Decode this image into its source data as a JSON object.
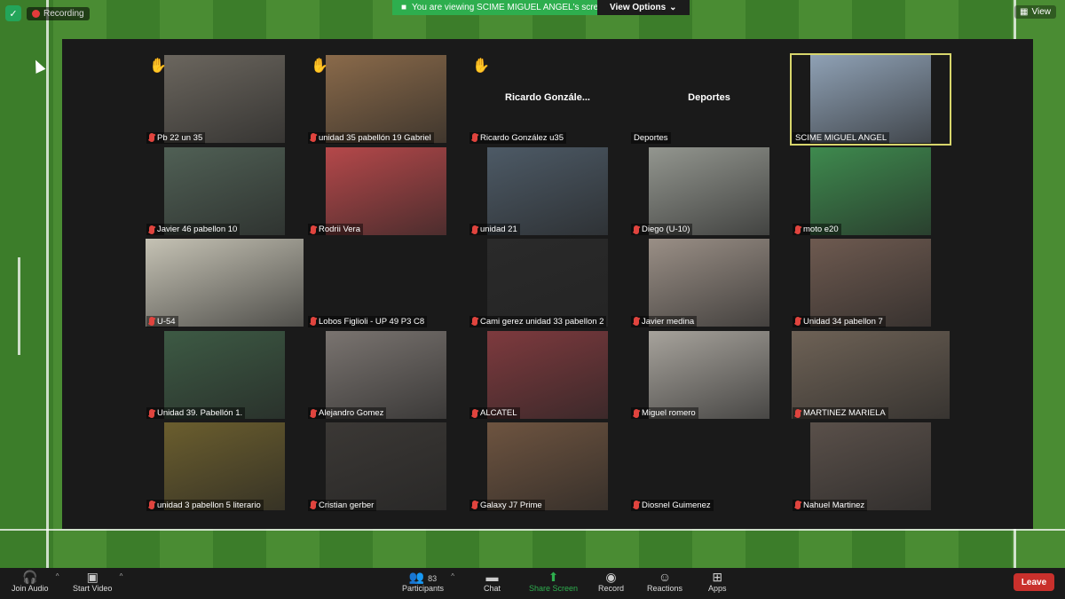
{
  "banner": {
    "recording_label": "Recording",
    "viewing_text": "You are viewing SCIME MIGUEL ANGEL's screen",
    "view_options_label": "View Options",
    "view_label": "View"
  },
  "tiles": [
    {
      "name": "Pb 22 un 35",
      "hand": true,
      "bg": "#6b665e"
    },
    {
      "name": "unidad 35 pabellón 19 Gabriel",
      "hand": true,
      "bg": "#8a6a4a"
    },
    {
      "name": "Ricardo González u35",
      "hand": true,
      "bg": "",
      "center": "Ricardo  Gonzále..."
    },
    {
      "name": "Deportes",
      "hand": false,
      "bg": "",
      "center": "Deportes",
      "nomute": true
    },
    {
      "name": "SCIME MIGUEL ANGEL",
      "hand": false,
      "bg": "#8fa1b5",
      "active": true,
      "nomute": true
    },
    {
      "name": "Javier 46 pabellon 10",
      "bg": "#506055"
    },
    {
      "name": "Rodrii Vera",
      "bg": "#b5484a"
    },
    {
      "name": "unidad 21",
      "bg": "#4d5a66"
    },
    {
      "name": "Diego (U-10)",
      "bg": "#93968f"
    },
    {
      "name": "moto e20",
      "bg": "#3e8a4e"
    },
    {
      "name": "U-54",
      "bg": "#c5c2b4",
      "wide": true
    },
    {
      "name": "Lobos Figlioli  - UP 49 P3 C8",
      "bg": ""
    },
    {
      "name": "Cami gerez unidad 33 pabellon 2",
      "bg": "#2a2a2a"
    },
    {
      "name": "Javier medina",
      "bg": "#9a8f86"
    },
    {
      "name": "Unidad 34 pabellon 7",
      "bg": "#6e5a50"
    },
    {
      "name": "Unidad 39. Pabellón 1.",
      "bg": "#3d5a44"
    },
    {
      "name": "Alejandro Gomez",
      "bg": "#7a7470"
    },
    {
      "name": "ALCATEL",
      "bg": "#7e3a3e"
    },
    {
      "name": "Miguel romero",
      "bg": "#a7a39c"
    },
    {
      "name": "MARTINEZ MARIELA",
      "bg": "#6e6256",
      "wide": true
    },
    {
      "name": "unidad 3 pabellon 5 literario",
      "bg": "#6b5e2e"
    },
    {
      "name": "Cristian gerber",
      "bg": "#3b3835"
    },
    {
      "name": "Galaxy J7 Prime",
      "bg": "#6e5440"
    },
    {
      "name": "Diosnel Guimenez",
      "bg": ""
    },
    {
      "name": "Nahuel Martinez",
      "bg": "#5a504a"
    }
  ],
  "toolbar": {
    "join_audio": "Join Audio",
    "start_video": "Start Video",
    "participants": "Participants",
    "participants_count": "83",
    "chat": "Chat",
    "share_screen": "Share Screen",
    "record": "Record",
    "reactions": "Reactions",
    "apps": "Apps",
    "leave": "Leave"
  }
}
